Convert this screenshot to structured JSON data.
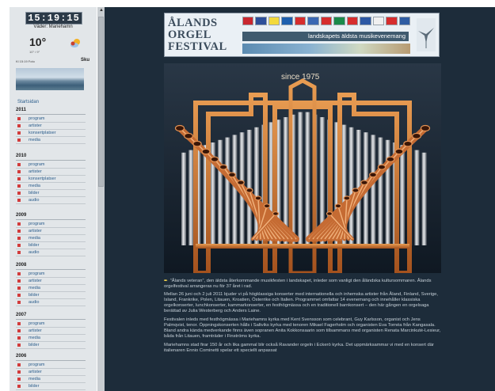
{
  "sidebar": {
    "clock": "15:19:15",
    "weather_place": "Väder: Mariehamn",
    "temperature": "10°",
    "temperature_detail": "10° / 9°",
    "time_info": "Kl 15:19  Foto",
    "aux_label": "Sku",
    "start_link": "Startsidan",
    "sections": [
      {
        "year": "2011",
        "items": [
          "program",
          "artister",
          "konsertplatser",
          "media"
        ]
      },
      {
        "year": "2010",
        "items": [
          "program",
          "artister",
          "konsertplatser",
          "media",
          "bilder",
          "audio"
        ]
      },
      {
        "year": "2009",
        "items": [
          "program",
          "artister",
          "media",
          "bilder",
          "audio"
        ]
      },
      {
        "year": "2008",
        "items": [
          "program",
          "artister",
          "media",
          "bilder",
          "audio"
        ]
      },
      {
        "year": "2007",
        "items": [
          "program",
          "artister",
          "media",
          "bilder"
        ]
      },
      {
        "year": "2006",
        "items": [
          "program",
          "artister",
          "media",
          "bilder"
        ]
      }
    ]
  },
  "banner": {
    "logo_text": "Ålands Orgel Festival",
    "tagline": "landskapets äldsta musikevenemang",
    "flag_colors": [
      "#c9272f",
      "#2d4f9a",
      "#f3d93c",
      "#1d5fae",
      "#d62d2d",
      "#3a68b3",
      "#d62d2d",
      "#1a8a4a",
      "#d62d2d",
      "#2c58a4",
      "#f0f0f0",
      "#d62d2d",
      "#2f5da3"
    ]
  },
  "organ": {
    "since_label": "since 1975"
  },
  "content": {
    "lead": "”Ålands veteran”, den äldsta återkommande musikfesten i landskapet, inleder som vanligt den åländska kultursommaren. Ålands orgelfestival arrangeras nu för 37 året i rad.",
    "paragraphs": [
      "Mellan 26 juni och 2 juli 2011 bjuder vi på högklassiga konserter med internationella och inhemska artister från Åland, Finland, Sverige, Island, Frankrike, Polen, Litauen, Kroatien, Österrike och Italien. Programmet omfattar 14 evenemang och innehåller klassiska orgelkonserter, lunchkonserter, kammarkonserter, en festhögmässa och en traditionell barnkonsert – den här gången en orgelsaga berättad av Julia Westerberg och Anders Laine.",
      "Festivalen inleds med festhögmässa i Mariehamns kyrka med Kent Svensson som celebrant, Guy Karlsson, organist och Jens Palmqvist, tenor. Öppningskonserten hålls i Saltviks kyrka med tenoren Mikael Fagerholm och organisten Eva Tornéa från Kangasala. Bland andra kända medverkande finns även sopranen Anita Kokkonsaarin som tillsammans med organisten Renata Marcinkutė-Lesieur, båda från Litauen, framträder i Finströms kyrka.",
      "Mariehamns stad firar 150 år och lika gammal blir också Ravander orgeln i Eckerö kyrka. Det uppmärksammar vi med en konsert där italienaren Ennio Cominetti spelar ett speciellt anpassat"
    ]
  }
}
